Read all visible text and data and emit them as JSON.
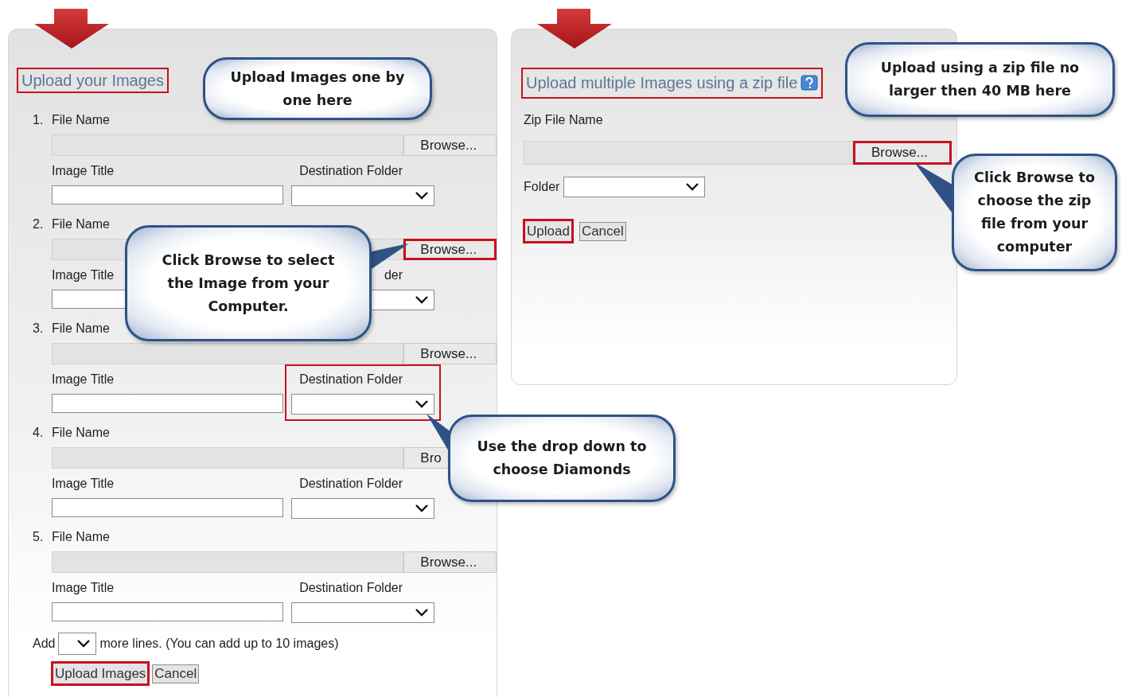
{
  "left_panel": {
    "title": {
      "text": "Upload your Images",
      "highlighted": true
    },
    "rows": [
      {
        "number": "1.",
        "file_label": "File Name",
        "browse": {
          "label": "Browse...",
          "highlighted": false
        },
        "title_label": "Image Title",
        "folder_label": "Destination Folder",
        "folder_highlighted": false
      },
      {
        "number": "2.",
        "file_label": "File Name",
        "browse": {
          "label": "Browse...",
          "highlighted": true
        },
        "title_label": "Image Title",
        "folder_label": "der",
        "folder_highlighted": false
      },
      {
        "number": "3.",
        "file_label": "File Name",
        "browse": {
          "label": "Browse...",
          "highlighted": false
        },
        "title_label": "Image Title",
        "folder_label": "Destination Folder",
        "folder_highlighted": true
      },
      {
        "number": "4.",
        "file_label": "File Name",
        "browse": {
          "label": "Bro",
          "highlighted": false
        },
        "title_label": "Image Title",
        "folder_label": "Destination Folder",
        "folder_highlighted": false
      },
      {
        "number": "5.",
        "file_label": "File Name",
        "browse": {
          "label": "Browse...",
          "highlighted": false
        },
        "title_label": "Image Title",
        "folder_label": "Destination Folder",
        "folder_highlighted": false
      }
    ],
    "add_lines": {
      "prefix": "Add",
      "suffix": "more lines. (You can add up to 10 images)"
    },
    "buttons": [
      {
        "label": "Upload Images",
        "highlighted": true
      },
      {
        "label": "Cancel",
        "highlighted": false
      }
    ]
  },
  "right_panel": {
    "title": {
      "text": "Upload multiple Images using a zip file",
      "highlighted": true
    },
    "zip_label": "Zip File Name",
    "browse": {
      "label": "Browse...",
      "highlighted": true
    },
    "folder_label": "Folder",
    "buttons": [
      {
        "label": "Upload",
        "highlighted": true
      },
      {
        "label": "Cancel",
        "highlighted": false
      }
    ]
  },
  "callouts": [
    {
      "text": "Upload Images one by one here",
      "kind": "plain"
    },
    {
      "text": "Click Browse to select the Image from your Computer.",
      "kind": "right"
    },
    {
      "text": "Use the drop down to choose Diamonds",
      "kind": "upleft"
    },
    {
      "text": "Upload using a zip file no larger then 40 MB here",
      "kind": "plain"
    },
    {
      "text": "Click Browse to choose the zip file from your computer",
      "kind": "left"
    }
  ]
}
